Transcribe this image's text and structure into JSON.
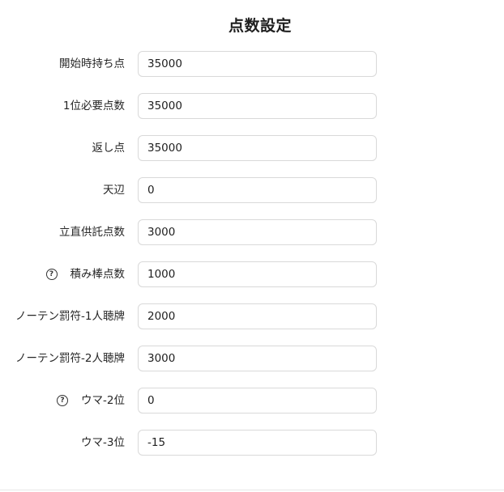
{
  "title": "点数設定",
  "fields": [
    {
      "label": "開始時持ち点",
      "value": "35000",
      "help": false
    },
    {
      "label": "1位必要点数",
      "value": "35000",
      "help": false
    },
    {
      "label": "返し点",
      "value": "35000",
      "help": false
    },
    {
      "label": "天辺",
      "value": "0",
      "help": false
    },
    {
      "label": "立直供託点数",
      "value": "3000",
      "help": false
    },
    {
      "label": "積み棒点数",
      "value": "1000",
      "help": true
    },
    {
      "label": "ノーテン罰符-1人聴牌",
      "value": "2000",
      "help": false
    },
    {
      "label": "ノーテン罰符-2人聴牌",
      "value": "3000",
      "help": false
    },
    {
      "label": "ウマ-2位",
      "value": "0",
      "help": true
    },
    {
      "label": "ウマ-3位",
      "value": "-15",
      "help": false
    }
  ],
  "icons": {
    "help": "question-circle-icon"
  },
  "help_glyph": "?"
}
